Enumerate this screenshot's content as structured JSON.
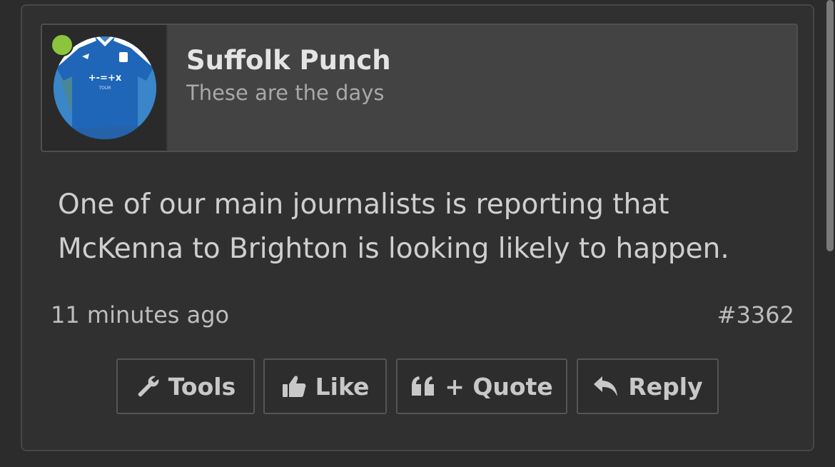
{
  "post": {
    "author": {
      "name": "Suffolk Punch",
      "title": "These are the days",
      "online": true,
      "avatar_icon": "football-shirt-avatar"
    },
    "message": "One of our main journalists is reporting that McKenna to Brighton is looking likely to happen.",
    "time": "11 minutes ago",
    "post_number": "#3362",
    "actions": {
      "tools": {
        "label": "Tools",
        "icon": "wrench-icon"
      },
      "like": {
        "label": "Like",
        "icon": "thumbs-up-icon"
      },
      "quote": {
        "label": "+ Quote",
        "icon": "quote-icon"
      },
      "reply": {
        "label": "Reply",
        "icon": "reply-icon"
      }
    }
  },
  "colors": {
    "background": "#2c2c2c",
    "panel": "#303030",
    "author_box": "#434343",
    "online": "#8cc43e",
    "avatar_blue": "#2d6fb2"
  }
}
